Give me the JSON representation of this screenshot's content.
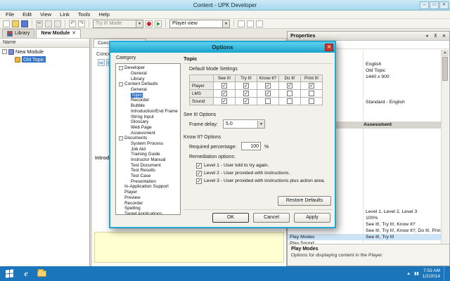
{
  "colors": {
    "dialog_accent": "#1ea8d2",
    "selection_blue": "#2f71c8",
    "taskbar_blue": "#1b75bb",
    "note_yellow": "#ffffd2",
    "close_red": "#c23a30"
  },
  "window": {
    "title": "Content - UPK Developer"
  },
  "menu": {
    "items": [
      "File",
      "Edit",
      "View",
      "Link",
      "Tools",
      "Help"
    ]
  },
  "toolbar": {
    "mode_combo": "Try It! Mode",
    "view_combo": "Player view",
    "icons": [
      "new",
      "open",
      "save",
      "cut",
      "copy",
      "paste",
      "undo",
      "redo",
      "record",
      "play"
    ]
  },
  "doc_tabs": {
    "library": "Library",
    "module": "New Module"
  },
  "library_panel": {
    "column_header": "Name",
    "tree": [
      {
        "label": "New Module",
        "exp": "-",
        "icon": "module"
      },
      {
        "label": "Old Topic",
        "level": 1,
        "selected": true,
        "icon": "topic"
      }
    ]
  },
  "editor": {
    "tab": "Concept/Introduction",
    "concept_label": "Concept",
    "introduction_label": "Introduction"
  },
  "properties": {
    "title": "Properties",
    "values": {
      "language": "English",
      "name": "Old Topic",
      "resolution": "1440 x 900",
      "template": "Standard - English",
      "section": "Assessment",
      "remediation": "Level 1, Level 2, Level 3",
      "required_percentage": "100%",
      "know_it_modes": "See It!, Try It!, Know It?",
      "play_modes_all": "See It!, Try It!, Know It?, Do It!, Print It!",
      "play_modes_name": "Play Modes",
      "play_modes_value": "See It!, Try It!",
      "play_sound_name": "Play Sound"
    },
    "description": {
      "title": "Play Modes",
      "text": "Options for displaying content in the Player."
    }
  },
  "dialog": {
    "title": "Options",
    "category_label": "Category",
    "tree": [
      {
        "label": "Developer",
        "exp": "-"
      },
      {
        "label": "General",
        "level": 1
      },
      {
        "label": "Library",
        "level": 1
      },
      {
        "label": "Content Defaults",
        "exp": "-"
      },
      {
        "label": "General",
        "level": 1
      },
      {
        "label": "Topic",
        "level": 1,
        "selected": true
      },
      {
        "label": "Recorder",
        "level": 1
      },
      {
        "label": "Bubble",
        "level": 1
      },
      {
        "label": "Introduction/End Frame",
        "level": 1
      },
      {
        "label": "String Input",
        "level": 1
      },
      {
        "label": "Glossary",
        "level": 1
      },
      {
        "label": "Web Page",
        "level": 1
      },
      {
        "label": "Assessment",
        "level": 1
      },
      {
        "label": "Documents",
        "exp": "-"
      },
      {
        "label": "System Process",
        "level": 1
      },
      {
        "label": "Job Aid",
        "level": 1
      },
      {
        "label": "Training Guide",
        "level": 1
      },
      {
        "label": "Instructor Manual",
        "level": 1
      },
      {
        "label": "Test Document",
        "level": 1
      },
      {
        "label": "Test Results",
        "level": 1
      },
      {
        "label": "Test Case",
        "level": 1
      },
      {
        "label": "Presentation",
        "level": 1
      },
      {
        "label": "In-Application Support"
      },
      {
        "label": "Player"
      },
      {
        "label": "Preview"
      },
      {
        "label": "Recorder"
      },
      {
        "label": "Spelling"
      },
      {
        "label": "Target Applications"
      }
    ],
    "content": {
      "header": "Topic",
      "mode_settings_label": "Default Mode Settings",
      "mode_table": {
        "columns": [
          "See It!",
          "Try It!",
          "Know It?",
          "Do It!",
          "Print It!"
        ],
        "rows": [
          {
            "label": "Player",
            "checks": [
              "✓",
              "✓",
              "✓",
              "✓",
              "✓"
            ]
          },
          {
            "label": "LMS",
            "checks": [
              "✓",
              "✓",
              "✓",
              "",
              ""
            ]
          },
          {
            "label": "Sound",
            "checks": [
              "✓",
              "✓",
              "",
              "",
              ""
            ]
          }
        ]
      },
      "see_it_label": "See It! Options",
      "frame_delay_label": "Frame delay:",
      "frame_delay_value": "5.0",
      "know_it_label": "Know It? Options",
      "required_pct_label": "Required percentage:",
      "required_pct_value": "100",
      "pct_suffix": "%",
      "remediation_label": "Remediation options:",
      "remediation": [
        {
          "checked": "✓",
          "label": "Level 1 - User told to try again."
        },
        {
          "checked": "✓",
          "label": "Level 2 - User provided with instructions."
        },
        {
          "checked": "✓",
          "label": "Level 3 - User provided with instructions plus action area."
        }
      ],
      "restore_button": "Restore Defaults",
      "ok": "OK",
      "cancel": "Cancel",
      "apply": "Apply"
    }
  },
  "taskbar": {
    "time": "7:53 AM",
    "date": "1/2/2014"
  }
}
